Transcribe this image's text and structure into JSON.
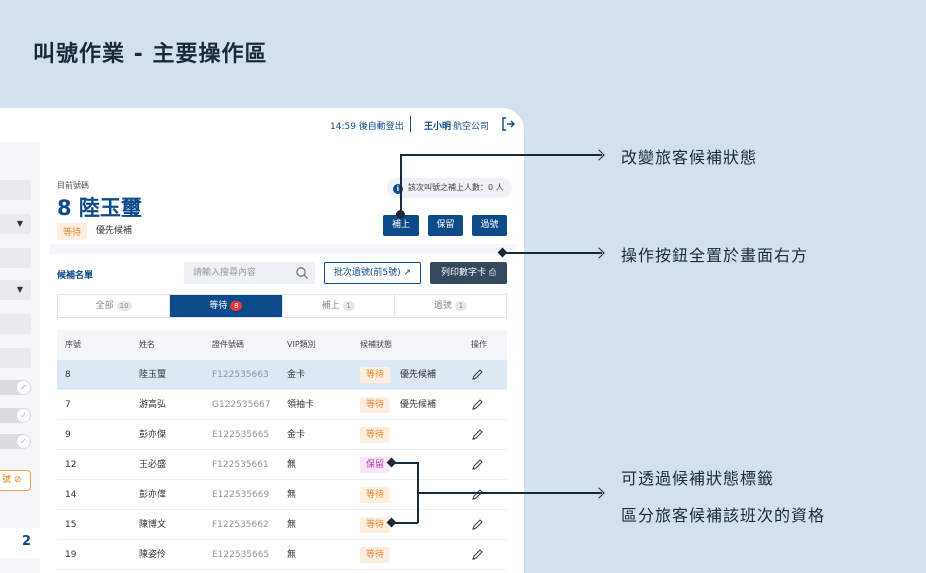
{
  "page_title": "叫號作業 - 主要操作區",
  "topbar": {
    "auto_logout": "14:59 後自動登出",
    "user_name": "王小明",
    "airline": "航空公司",
    "logout_icon": "logout-icon"
  },
  "left_panel": {
    "button_label": "號",
    "count": "2"
  },
  "current": {
    "label": "目前號碼",
    "number": "8 陸玉璽",
    "status": "等待",
    "priority": "優先候補",
    "info": "該次叫號之補上人數：0 人",
    "actions": [
      "補上",
      "保留",
      "過號"
    ]
  },
  "list": {
    "title": "候補名單",
    "search_placeholder": "請輸入搜尋內容",
    "batch_label": "批次過號(前5號)",
    "print_label": "列印數字卡",
    "tabs": [
      {
        "label": "全部",
        "count": "10"
      },
      {
        "label": "等待",
        "count": "8"
      },
      {
        "label": "補上",
        "count": "1"
      },
      {
        "label": "過號",
        "count": "1"
      }
    ],
    "columns": [
      "序號",
      "姓名",
      "證件號碼",
      "VIP類別",
      "候補狀態",
      "操作"
    ],
    "rows": [
      {
        "no": "8",
        "name": "陸玉璽",
        "id": "F122535663",
        "vip": "金卡",
        "status": "等待",
        "priority": "優先候補"
      },
      {
        "no": "7",
        "name": "游高弘",
        "id": "G122535667",
        "vip": "領袖卡",
        "status": "等待",
        "priority": "優先候補"
      },
      {
        "no": "9",
        "name": "彭亦傑",
        "id": "E122535665",
        "vip": "金卡",
        "status": "等待",
        "priority": ""
      },
      {
        "no": "12",
        "name": "王必盛",
        "id": "F122535661",
        "vip": "無",
        "status": "保留",
        "priority": ""
      },
      {
        "no": "14",
        "name": "彭亦偉",
        "id": "E122535669",
        "vip": "無",
        "status": "等待",
        "priority": ""
      },
      {
        "no": "15",
        "name": "陳博文",
        "id": "F122535662",
        "vip": "無",
        "status": "等待",
        "priority": ""
      },
      {
        "no": "19",
        "name": "陳姿伶",
        "id": "E122535665",
        "vip": "無",
        "status": "等待",
        "priority": ""
      }
    ]
  },
  "annotations": {
    "a1": "改變旅客候補狀態",
    "a2": "操作按鈕全置於畫面右方",
    "a3_line1": "可透過候補狀態標籤",
    "a3_line2": "區分旅客候補該班次的資格"
  },
  "colors": {
    "primary": "#0d4a8a",
    "background": "#d3e1ef",
    "wait_tag": "#e88a3a",
    "hold_tag": "#b23aa8",
    "badge_red": "#e53935"
  }
}
